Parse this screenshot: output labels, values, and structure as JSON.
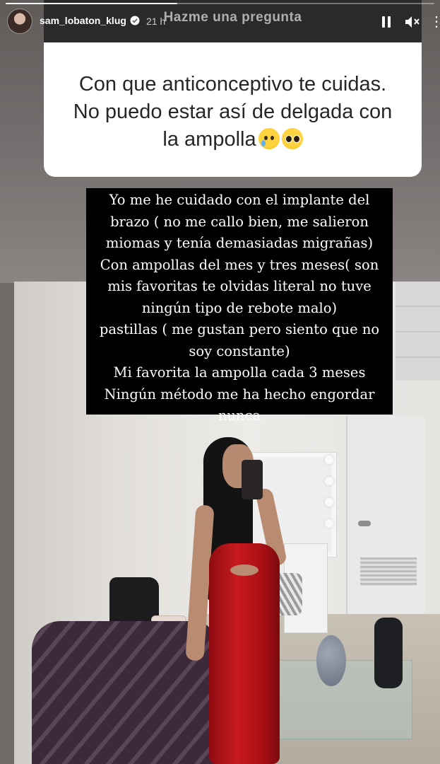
{
  "story": {
    "username": "sam_lobaton_klug",
    "time_ago": "21 h",
    "progress_fraction": 0.4,
    "icons": {
      "verified": "verified-badge-icon",
      "pause": "pause-icon",
      "mute": "mute-icon",
      "more": "more-options-icon"
    }
  },
  "question_sticker": {
    "title": "Hazme una pregunta",
    "question": "Con que anticonceptivo te cuidas. No puedo estar así de delgada con la ampolla",
    "emojis": [
      "crying-face-emoji",
      "pleading-face-emoji"
    ]
  },
  "answer": {
    "text": "Yo me he cuidado con el implante del\nbrazo ( no me callo bien, me salieron\nmiomas y tenía demasiadas migrañas)\nCon ampollas del mes y tres meses( son\nmis favoritas te olvidas literal no tuve\nningún tipo de rebote malo)\npastillas ( me gustan pero siento que no\nsoy constante)\nMi favorita la ampolla cada 3 meses\nNingún método me ha hecho engordar\nnunca"
  },
  "colors": {
    "sticker_header": "#2a2a2c",
    "sticker_body": "#ffffff",
    "answer_bg": "#000000",
    "dress": "#c71a1f"
  }
}
